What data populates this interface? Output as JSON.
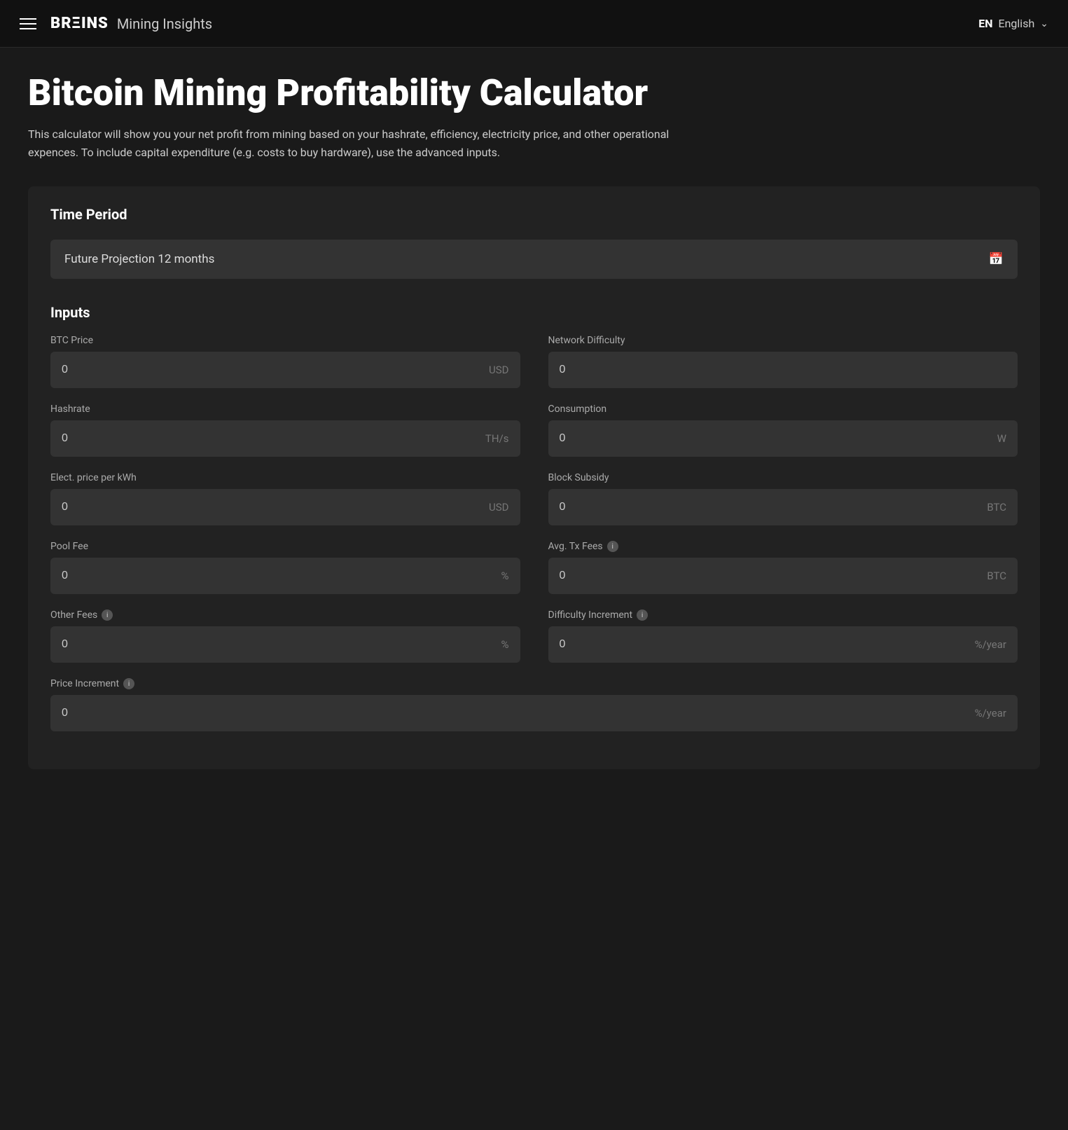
{
  "navbar": {
    "brand_logo": "BRΞINS",
    "brand_subtitle": "Mining Insights",
    "lang_code": "EN",
    "lang_label": "English",
    "hamburger_aria": "Open menu"
  },
  "page": {
    "title": "Bitcoin Mining Profitability Calculator",
    "description": "This calculator will show you your net profit from mining based on your hashrate, efficiency, electricity price, and other operational expences. To include capital expenditure (e.g. costs to buy hardware), use the advanced inputs."
  },
  "time_period": {
    "section_title": "Time Period",
    "selected_value": "Future Projection 12 months",
    "calendar_aria": "Select date range"
  },
  "inputs": {
    "section_title": "Inputs",
    "fields": [
      {
        "label": "BTC Price",
        "value": "0",
        "unit": "USD",
        "has_info": false,
        "name": "btc-price-input"
      },
      {
        "label": "Network Difficulty",
        "value": "0",
        "unit": "",
        "has_info": false,
        "name": "network-difficulty-input"
      },
      {
        "label": "Hashrate",
        "value": "0",
        "unit": "TH/s",
        "has_info": false,
        "name": "hashrate-input"
      },
      {
        "label": "Consumption",
        "value": "0",
        "unit": "W",
        "has_info": false,
        "name": "consumption-input"
      },
      {
        "label": "Elect. price per kWh",
        "value": "0",
        "unit": "USD",
        "has_info": false,
        "name": "electricity-price-input"
      },
      {
        "label": "Block Subsidy",
        "value": "0",
        "unit": "BTC",
        "has_info": false,
        "name": "block-subsidy-input"
      },
      {
        "label": "Pool Fee",
        "value": "0",
        "unit": "%",
        "has_info": false,
        "name": "pool-fee-input"
      },
      {
        "label": "Avg. Tx Fees",
        "value": "0",
        "unit": "BTC",
        "has_info": true,
        "name": "avg-tx-fees-input"
      },
      {
        "label": "Other Fees",
        "value": "0",
        "unit": "%",
        "has_info": true,
        "name": "other-fees-input"
      },
      {
        "label": "Difficulty Increment",
        "value": "0",
        "unit": "%/year",
        "has_info": true,
        "name": "difficulty-increment-input"
      }
    ],
    "price_increment": {
      "label": "Price Increment",
      "value": "0",
      "unit": "%/year",
      "has_info": true,
      "name": "price-increment-input"
    }
  }
}
